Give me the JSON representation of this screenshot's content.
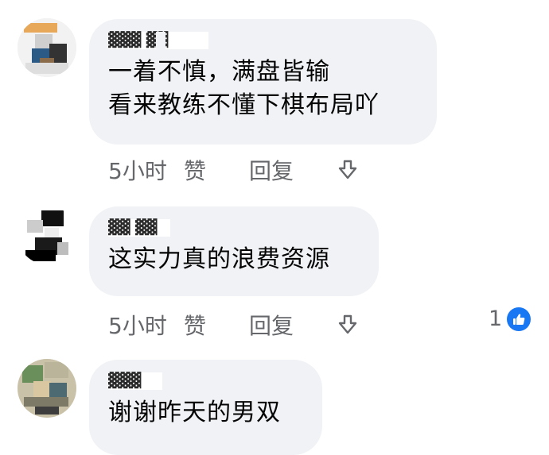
{
  "comments": [
    {
      "author": "▓▓▓ ▓▓",
      "text": "一着不慎，满盘皆输\n看来教练不懂下棋布局吖",
      "time": "5小时",
      "like_label": "赞",
      "reply_label": "回复",
      "share_icon": "share-arrow-icon"
    },
    {
      "author": "▓▓ ▓▓",
      "text": "这实力真的浪费资源",
      "time": "5小时",
      "like_label": "赞",
      "reply_label": "回复",
      "share_icon": "share-arrow-icon",
      "reaction_count": "1",
      "reaction_icon": "like-badge-icon"
    },
    {
      "author": "▓▓▓",
      "text": "谢谢昨天的男双"
    }
  ],
  "colors": {
    "bubble": "#f0f2f5",
    "muted_text": "#65676b",
    "like_blue": "#1877f2"
  }
}
